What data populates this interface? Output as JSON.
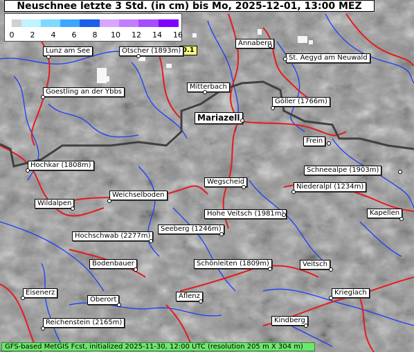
{
  "title": "Neuschnee letzte 3 Std. (in cm) bis Mo, 2025-12-01, 13:00 MEZ",
  "legend": {
    "ticks": [
      "0",
      "2",
      "4",
      "6",
      "8",
      "10",
      "12",
      "14",
      "16"
    ],
    "colors": [
      "#d0d0d0",
      "#bff3ff",
      "#7fd8ff",
      "#3da6ff",
      "#1c5fe8",
      "#d8a6ff",
      "#bf7fff",
      "#a64cff",
      "#8000ff"
    ]
  },
  "value_badge": "0.1",
  "places": [
    {
      "id": "lunz-am-see",
      "label": "Lunz am See"
    },
    {
      "id": "oetscher",
      "label": "Ötscher (1893m)"
    },
    {
      "id": "annaberg",
      "label": "Annaberg"
    },
    {
      "id": "st-aegyd",
      "label": "St. Aegyd am Neuwald"
    },
    {
      "id": "goestling",
      "label": "Goestling an der Ybbs"
    },
    {
      "id": "mitterbach",
      "label": "Mitterbach"
    },
    {
      "id": "goeller",
      "label": "Göller (1766m)"
    },
    {
      "id": "mariazell",
      "label": "Mariazell"
    },
    {
      "id": "frein",
      "label": "Frein"
    },
    {
      "id": "hochkar",
      "label": "Hochkar (1808m)"
    },
    {
      "id": "schneealpe",
      "label": "Schneealpe (1903m)"
    },
    {
      "id": "wegscheid",
      "label": "Wegscheid"
    },
    {
      "id": "niederalpl",
      "label": "Niederalpl (1234m)"
    },
    {
      "id": "weichselboden",
      "label": "Weichselboden"
    },
    {
      "id": "wildalpen",
      "label": "Wildalpen"
    },
    {
      "id": "hohe-veitsch",
      "label": "Hohe Veitsch (1981m)"
    },
    {
      "id": "kapellen",
      "label": "Kapellen"
    },
    {
      "id": "seeberg",
      "label": "Seeberg (1246m)"
    },
    {
      "id": "hochschwab",
      "label": "Hochschwab (2277m)"
    },
    {
      "id": "bodenbauer",
      "label": "Bodenbauer"
    },
    {
      "id": "schoenleiten",
      "label": "Schönleiten (1809m)"
    },
    {
      "id": "veitsch",
      "label": "Veitsch"
    },
    {
      "id": "eisenerz",
      "label": "Eisenerz"
    },
    {
      "id": "oberort",
      "label": "Oberort"
    },
    {
      "id": "aflenz",
      "label": "Aflenz"
    },
    {
      "id": "krieglach",
      "label": "Krieglach"
    },
    {
      "id": "reichenstein",
      "label": "Reichenstein (2165m)"
    },
    {
      "id": "kindberg",
      "label": "Kindberg"
    }
  ],
  "footer": "GFS-based MetGIS Fcst, initialized 2025-11-30, 12:00 UTC  (resolution 205 m X 304 m)",
  "colors": {
    "river": "#1a3cff",
    "road": "#e8191f",
    "border": "#404040",
    "terrain": "#8f8f8f",
    "snow": "#ffffff"
  }
}
